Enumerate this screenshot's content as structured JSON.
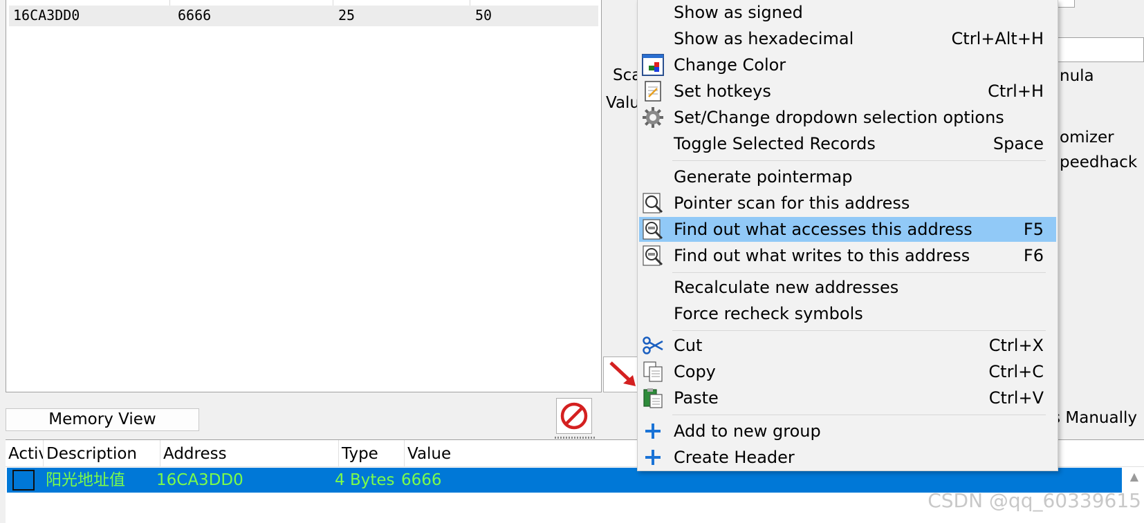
{
  "found_list": {
    "row": {
      "address": "16CA3DD0",
      "value": "6666",
      "previous": "25",
      "first": "50"
    }
  },
  "right_fragments": {
    "sca": "Sca",
    "valu": "Valu",
    "nula": "nula",
    "omizer": "omizer",
    "peedhack": "peedhack",
    "manually": "s Manually"
  },
  "memory_view_label": "Memory View",
  "cheat_table": {
    "headers": [
      "Activ",
      "Description",
      "Address",
      "Type",
      "Value"
    ],
    "row": {
      "description": "阳光地址值",
      "address": "16CA3DD0",
      "type": "4 Bytes",
      "value": "6666"
    }
  },
  "context_menu": {
    "items": [
      {
        "label": "Show as signed",
        "shortcut": ""
      },
      {
        "label": "Show as hexadecimal",
        "shortcut": "Ctrl+Alt+H"
      },
      {
        "label": "Change Color",
        "shortcut": "",
        "icon": "palette-icon"
      },
      {
        "label": "Set hotkeys",
        "shortcut": "Ctrl+H",
        "icon": "notepad-icon"
      },
      {
        "label": "Set/Change dropdown selection options",
        "shortcut": "",
        "icon": "gear-icon"
      },
      {
        "label": "Toggle Selected Records",
        "shortcut": "Space"
      },
      {
        "label": "Generate pointermap",
        "shortcut": ""
      },
      {
        "label": "Pointer scan for this address",
        "shortcut": "",
        "icon": "magnifier-icon"
      },
      {
        "label": "Find out what accesses this address",
        "shortcut": "F5",
        "icon": "asm-magnifier-icon",
        "highlighted": true
      },
      {
        "label": "Find out what writes to this address",
        "shortcut": "F6",
        "icon": "asm-magnifier-icon"
      },
      {
        "label": "Recalculate new addresses",
        "shortcut": ""
      },
      {
        "label": "Force recheck symbols",
        "shortcut": ""
      },
      {
        "label": "Cut",
        "shortcut": "Ctrl+X",
        "icon": "scissors-icon"
      },
      {
        "label": "Copy",
        "shortcut": "Ctrl+C",
        "icon": "copy-icon"
      },
      {
        "label": "Paste",
        "shortcut": "Ctrl+V",
        "icon": "paste-icon"
      },
      {
        "label": "Add to new group",
        "shortcut": "",
        "icon": "plus-icon"
      },
      {
        "label": "Create Header",
        "shortcut": "",
        "icon": "plus-icon"
      }
    ]
  },
  "watermark": "CSDN @qq_60339615",
  "colors": {
    "selection": "#0078d7",
    "selection_text": "#7cfc4a",
    "menu_highlight": "#91c9f7",
    "menu_bg": "#f2f2f2"
  }
}
